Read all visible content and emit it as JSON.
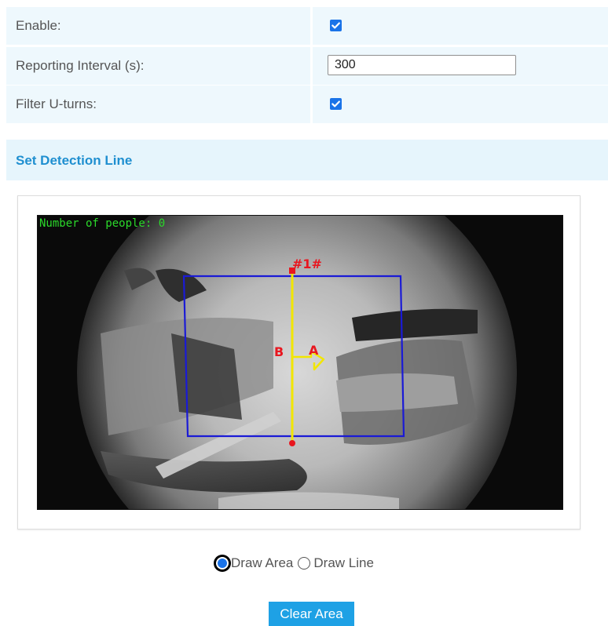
{
  "settings": {
    "enable_label": "Enable:",
    "enable_checked": true,
    "interval_label": "Reporting Interval (s):",
    "interval_value": "300",
    "uturn_label": "Filter U-turns:",
    "uturn_checked": true
  },
  "section": {
    "title": "Set Detection Line"
  },
  "video": {
    "overlay_text": "Number of people: 0",
    "line_id": "#1#",
    "side_b": "B",
    "side_a": "A",
    "area_color": "#1a1ad6",
    "line_color": "#f2e600",
    "marker_color": "#e8161f"
  },
  "mode": {
    "draw_area_label": "Draw Area",
    "draw_line_label": "Draw Line",
    "selected": "Draw Area"
  },
  "actions": {
    "clear_label": "Clear Area"
  },
  "colors": {
    "accent": "#1ea1e5",
    "row_bg": "#eef8fd",
    "header_text": "#1f8fd0"
  }
}
